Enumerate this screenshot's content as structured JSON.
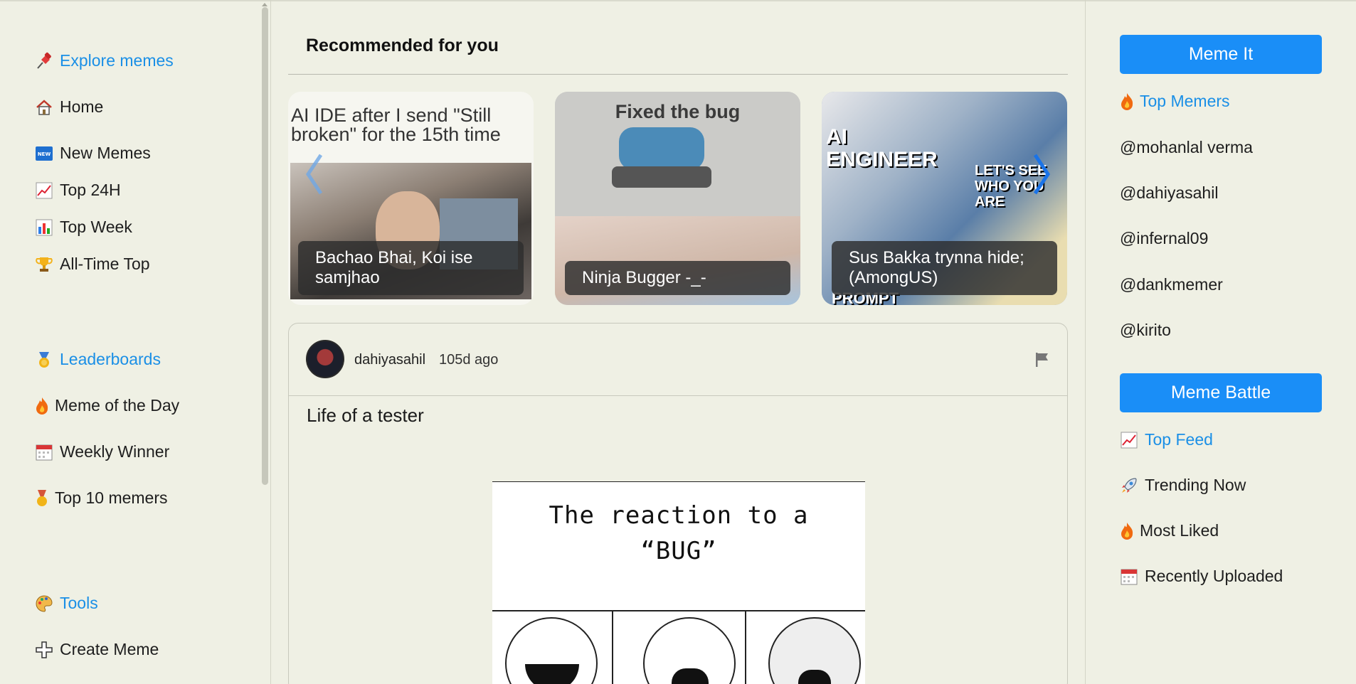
{
  "left_nav": {
    "explore": {
      "label": "Explore memes",
      "icon": "pushpin-icon"
    },
    "home": {
      "label": "Home",
      "icon": "house-icon"
    },
    "new_memes": {
      "label": "New Memes",
      "icon": "new-badge-icon",
      "badge": "NEW"
    },
    "top24h": {
      "label": "Top 24H",
      "icon": "chart-increasing-icon"
    },
    "top_week": {
      "label": "Top Week",
      "icon": "bar-chart-icon"
    },
    "all_time": {
      "label": "All-Time Top",
      "icon": "trophy-icon"
    },
    "leaderboards": {
      "label": "Leaderboards",
      "icon": "medal-icon"
    },
    "meme_of_day": {
      "label": "Meme of the Day",
      "icon": "fire-icon"
    },
    "weekly_winner": {
      "label": "Weekly Winner",
      "icon": "calendar-icon"
    },
    "top10": {
      "label": "Top 10 memers",
      "icon": "medal-icon"
    },
    "tools": {
      "label": "Tools",
      "icon": "palette-icon"
    },
    "create": {
      "label": "Create Meme",
      "icon": "plus-icon"
    }
  },
  "main": {
    "recommended_title": "Recommended for you",
    "cards": [
      {
        "image_text": "AI IDE after I send \"Still broken\" for the 15th time",
        "caption": "Bachao Bhai, Koi ise samjhao"
      },
      {
        "image_text": "Fixed the bug",
        "caption": "Ninja Bugger -_-"
      },
      {
        "image_text_1": "AI ENGINEER",
        "image_text_2": "LET'S SEE WHO YOU ARE",
        "image_text_3": "PROMPT",
        "caption": "Sus Bakka trynna hide; (AmongUS)"
      }
    ],
    "post": {
      "username": "dahiyasahil",
      "time": "105d ago",
      "title": "Life of a tester",
      "image_line1": "The reaction to a",
      "image_line2": "“BUG”"
    }
  },
  "right_nav": {
    "meme_it": "Meme It",
    "top_memers": {
      "label": "Top Memers",
      "icon": "fire-icon"
    },
    "memers": [
      "@mohanlal verma",
      "@dahiyasahil",
      "@infernal09",
      "@dankmemer",
      "@kirito"
    ],
    "meme_battle": "Meme Battle",
    "top_feed": {
      "label": "Top Feed",
      "icon": "chart-increasing-icon"
    },
    "trending": {
      "label": "Trending Now",
      "icon": "rocket-icon"
    },
    "most_liked": {
      "label": "Most Liked",
      "icon": "fire-icon"
    },
    "recent": {
      "label": "Recently Uploaded",
      "icon": "calendar-icon"
    }
  },
  "colors": {
    "background": "#eff0e4",
    "accent": "#1a8ef7",
    "link": "#1a8fe6"
  }
}
